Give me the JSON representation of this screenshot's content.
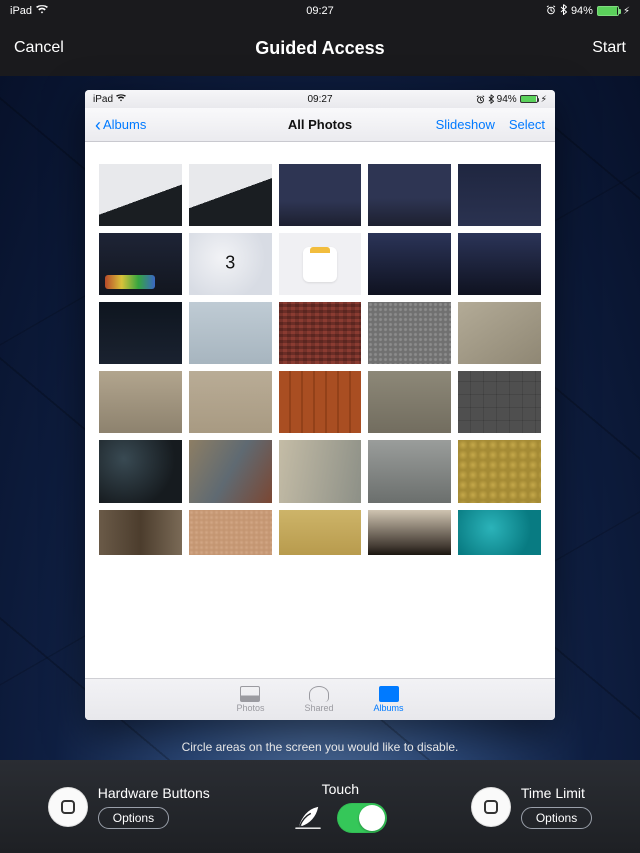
{
  "status_bar": {
    "device": "iPad",
    "time": "09:27",
    "battery_pct": "94%"
  },
  "nav": {
    "cancel": "Cancel",
    "title": "Guided Access",
    "start": "Start"
  },
  "preview": {
    "status": {
      "device": "iPad",
      "time": "09:27",
      "battery_pct": "94%"
    },
    "nav": {
      "back": "Albums",
      "title": "All Photos",
      "slideshow": "Slideshow",
      "select": "Select"
    },
    "tabs": {
      "photos": "Photos",
      "shared": "Shared",
      "albums": "Albums"
    }
  },
  "hint": "Circle areas on the screen you would like to disable.",
  "bottom": {
    "hardware": {
      "label": "Hardware Buttons",
      "options": "Options"
    },
    "touch": {
      "label": "Touch",
      "on": true
    },
    "time_limit": {
      "label": "Time Limit",
      "options": "Options"
    }
  }
}
